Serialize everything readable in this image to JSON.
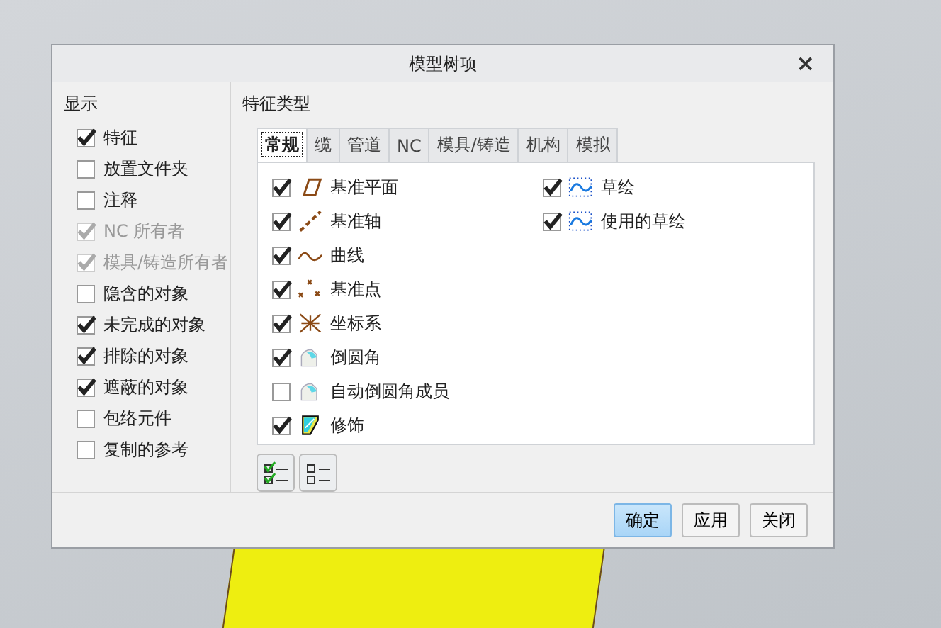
{
  "window": {
    "title": "模型树项",
    "close": "×"
  },
  "display": {
    "heading": "显示",
    "items": [
      {
        "label": "特征",
        "checked": true,
        "disabled": false
      },
      {
        "label": "放置文件夹",
        "checked": false,
        "disabled": false
      },
      {
        "label": "注释",
        "checked": false,
        "disabled": false
      },
      {
        "label": "NC 所有者",
        "checked": true,
        "disabled": true
      },
      {
        "label": "模具/铸造所有者",
        "checked": true,
        "disabled": true
      },
      {
        "label": "隐含的对象",
        "checked": false,
        "disabled": false
      },
      {
        "label": "未完成的对象",
        "checked": true,
        "disabled": false
      },
      {
        "label": "排除的对象",
        "checked": true,
        "disabled": false
      },
      {
        "label": "遮蔽的对象",
        "checked": true,
        "disabled": false
      },
      {
        "label": "包络元件",
        "checked": false,
        "disabled": false
      },
      {
        "label": "复制的参考",
        "checked": false,
        "disabled": false
      }
    ]
  },
  "feature_types": {
    "heading": "特征类型",
    "tabs": [
      {
        "label": "常规",
        "selected": true
      },
      {
        "label": "缆",
        "selected": false
      },
      {
        "label": "管道",
        "selected": false
      },
      {
        "label": "NC",
        "selected": false
      },
      {
        "label": "模具/铸造",
        "selected": false
      },
      {
        "label": "机构",
        "selected": false
      },
      {
        "label": "模拟",
        "selected": false
      }
    ],
    "columns": [
      [
        {
          "label": "基准平面",
          "checked": true
        },
        {
          "label": "基准轴",
          "checked": true
        },
        {
          "label": "曲线",
          "checked": true
        },
        {
          "label": "基准点",
          "checked": true
        },
        {
          "label": "坐标系",
          "checked": true
        },
        {
          "label": "倒圆角",
          "checked": true
        },
        {
          "label": "自动倒圆角成员",
          "checked": false
        },
        {
          "label": "修饰",
          "checked": true
        }
      ],
      [
        {
          "label": "草绘",
          "checked": true
        },
        {
          "label": "使用的草绘",
          "checked": true
        }
      ]
    ]
  },
  "buttons": [
    {
      "label": "确定",
      "default": true
    },
    {
      "label": "应用",
      "default": false
    },
    {
      "label": "关闭",
      "default": false
    }
  ]
}
